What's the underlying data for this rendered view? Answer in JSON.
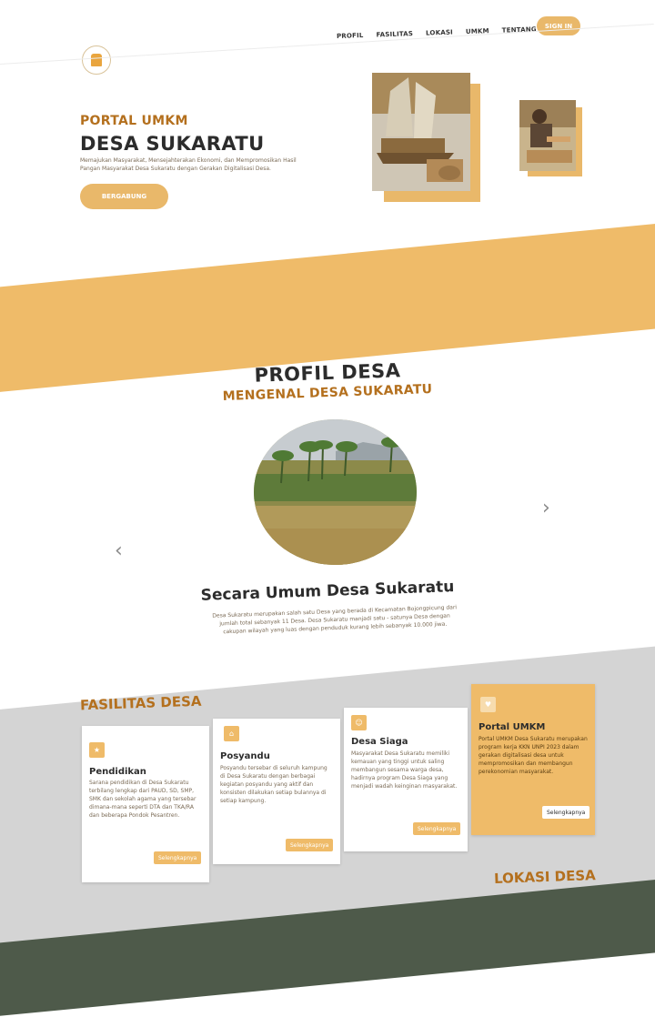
{
  "nav": {
    "items": [
      "PROFIL",
      "FASILITAS",
      "LOKASI",
      "UMKM",
      "TENTANG KAMI"
    ],
    "signin_label": "SIGN IN"
  },
  "hero": {
    "pre_title": "PORTAL UMKM",
    "title": "DESA SUKARATU",
    "description": "Memajukan Masyarakat, Mensejahterakan Ekonomi, dan Mempromosikan Hasil Pangan Masyarakat Desa Sukaratu dengan Gerakan Digitalisasi Desa.",
    "join_label": "BERGABUNG"
  },
  "profil": {
    "title": "PROFIL DESA",
    "subtitle": "MENGENAL DESA SUKARATU",
    "heading": "Secara Umum Desa Sukaratu",
    "description": "Desa Sukaratu merupakan salah satu Desa yang berada di Kecamatan Bojongpicung dari jumlah total sebanyak 11 Desa. Desa Sukaratu manjadi satu - satunya Desa dengan cakupan wilayah yang luas dengan penduduk kurang lebih sebanyak 10.000 jiwa.",
    "prev_icon": "‹",
    "next_icon": "›"
  },
  "fasilitas": {
    "title": "FASILITAS DESA",
    "cards": [
      {
        "icon": "star-icon",
        "title": "Pendidikan",
        "desc": "Sarana pendidikan di Desa Sukaratu terbilang lengkap dari PAUD, SD, SMP, SMK dan sekolah agama yang tersebar dimana-mana seperti DTA dan TKA/RA dan beberapa Pondok Pesantren.",
        "button": "Selengkapnya"
      },
      {
        "icon": "house-icon",
        "title": "Posyandu",
        "desc": "Posyandu tersebar di seluruh kampung di Desa Sukaratu dengan berbagai kegiatan posyandu yang aktif dan konsisten dilakukan setiap bulannya di setiap kampung.",
        "button": "Selengkapnya"
      },
      {
        "icon": "people-icon",
        "title": "Desa Siaga",
        "desc": "Masyarakat Desa Sukaratu memiliki kemauan yang tinggi untuk saling membangun sesama warga desa, hadirnya program Desa Siaga yang menjadi wadah keinginan masyarakat.",
        "button": "Selengkapnya"
      },
      {
        "icon": "thumbs-up-icon",
        "title": "Portal UMKM",
        "desc": "Portal UMKM Desa Sukaratu merupakan program kerja KKN UNPI 2023 dalam gerakan digitalisasi desa untuk mempromosikan dan membangun perekonomian masyarakat.",
        "button": "Selengkapnya"
      }
    ]
  },
  "lokasi": {
    "title": "LOKASI DESA"
  },
  "colors": {
    "accent": "#efbb69",
    "accent_text": "#b4701e",
    "grey": "#d4d4d4"
  }
}
